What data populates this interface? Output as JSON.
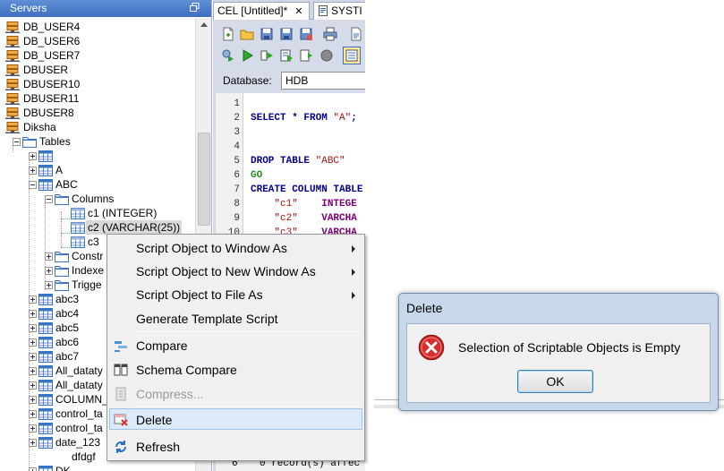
{
  "servers_panel": {
    "title": "Servers",
    "tree": {
      "servers": [
        "DB_USER4",
        "DB_USER6",
        "DB_USER7",
        "DBUSER",
        "DBUSER10",
        "DBUSER11",
        "DBUSER8",
        "Diksha"
      ],
      "tables_folder": "Tables",
      "tables_top": [
        "",
        "A",
        "ABC"
      ],
      "columns_folder": "Columns",
      "columns": [
        "c1 (INTEGER)",
        "c2 (VARCHAR(25))",
        "c3"
      ],
      "abc_folders": [
        "Constr",
        "Indexe",
        "Trigge"
      ],
      "tables_rest": [
        "abc3",
        "abc4",
        "abc5",
        "abc6",
        "abc7",
        "All_dataty",
        "All_dataty",
        "COLUMN_",
        "control_ta",
        "control_ta",
        "date_123"
      ],
      "child_item": "dfdgf",
      "last_item": "DK"
    }
  },
  "editor": {
    "tabs": [
      {
        "label": "CEL [Untitled]*",
        "close": "✕"
      },
      {
        "label": "SYSTI"
      }
    ],
    "database_label": "Database:",
    "database_value": "HDB",
    "code_lines": [
      {
        "n": "1",
        "text": ""
      },
      {
        "n": "2",
        "text": "SELECT * FROM \"A\";"
      },
      {
        "n": "3",
        "text": ""
      },
      {
        "n": "4",
        "text": ""
      },
      {
        "n": "5",
        "text": "DROP TABLE \"ABC\""
      },
      {
        "n": "6",
        "text": "GO"
      },
      {
        "n": "7",
        "text": "CREATE COLUMN TABLE"
      },
      {
        "n": "8",
        "text": "    \"c1\"    INTEGE"
      },
      {
        "n": "9",
        "text": "    \"c2\"    VARCHA"
      },
      {
        "n": "10",
        "text": "    \"c3\"    VARCHA"
      }
    ],
    "result_line_number": "6",
    "result_text": "0 record(s) affec"
  },
  "context_menu": {
    "items": [
      {
        "label": "Script Object to Window As",
        "submenu": true
      },
      {
        "label": "Script Object to New Window As",
        "submenu": true
      },
      {
        "label": "Script Object to File As",
        "submenu": true
      },
      {
        "label": "Generate Template Script"
      },
      {
        "label": "Compare"
      },
      {
        "label": "Schema Compare"
      },
      {
        "label": "Compress...",
        "disabled": true
      },
      {
        "label": "Delete",
        "highlighted": true
      },
      {
        "label": "Refresh"
      }
    ]
  },
  "dialog": {
    "title": "Delete",
    "message": "Selection of Scriptable Objects is Empty",
    "ok_label": "OK"
  },
  "colors": {
    "panel_header": "#4a7cc8",
    "menu_highlight": "#dbe9f8",
    "dialog_frame": "#c7d8ea",
    "error_red": "#d32f2f"
  }
}
